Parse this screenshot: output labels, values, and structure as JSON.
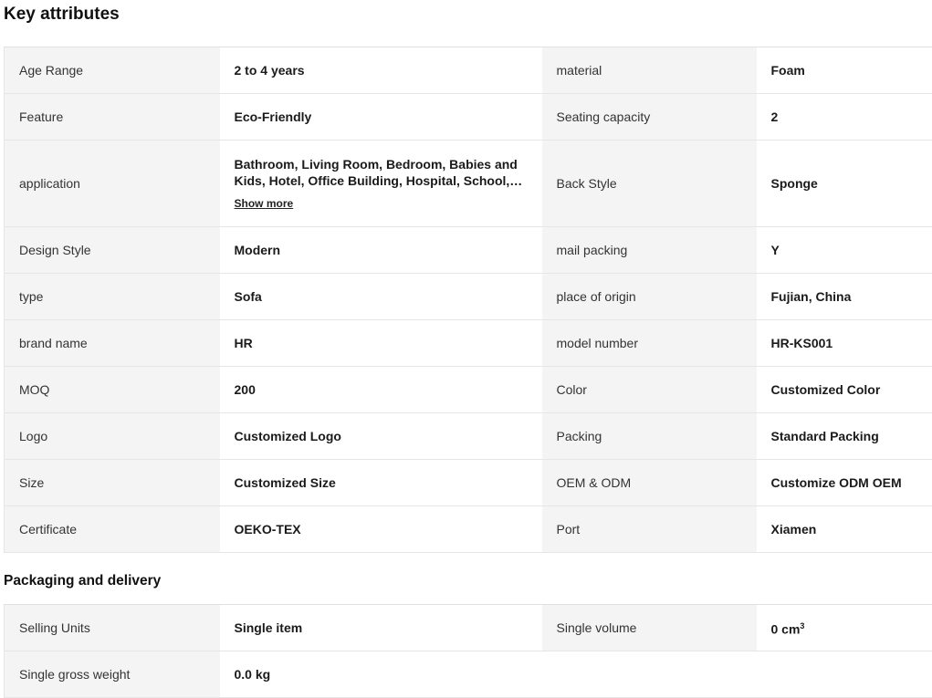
{
  "key_attributes": {
    "title": "Key attributes",
    "rows": [
      [
        {
          "label": "Age Range",
          "value": "2 to 4 years"
        },
        {
          "label": "material",
          "value": "Foam"
        }
      ],
      [
        {
          "label": "Feature",
          "value": "Eco-Friendly"
        },
        {
          "label": "Seating capacity",
          "value": "2"
        }
      ],
      [
        {
          "label": "application",
          "value": "Bathroom, Living Room, Bedroom, Babies and Kids, Hotel, Office Building, Hospital, School, Mall",
          "show_more": "Show more"
        },
        {
          "label": "Back Style",
          "value": "Sponge"
        }
      ],
      [
        {
          "label": "Design Style",
          "value": "Modern"
        },
        {
          "label": "mail packing",
          "value": "Y"
        }
      ],
      [
        {
          "label": "type",
          "value": "Sofa"
        },
        {
          "label": "place of origin",
          "value": "Fujian, China"
        }
      ],
      [
        {
          "label": "brand name",
          "value": "HR"
        },
        {
          "label": "model number",
          "value": "HR-KS001"
        }
      ],
      [
        {
          "label": "MOQ",
          "value": "200"
        },
        {
          "label": "Color",
          "value": "Customized Color"
        }
      ],
      [
        {
          "label": "Logo",
          "value": "Customized Logo"
        },
        {
          "label": "Packing",
          "value": "Standard Packing"
        }
      ],
      [
        {
          "label": "Size",
          "value": "Customized Size"
        },
        {
          "label": "OEM & ODM",
          "value": "Customize ODM OEM"
        }
      ],
      [
        {
          "label": "Certificate",
          "value": "OEKO-TEX"
        },
        {
          "label": "Port",
          "value": "Xiamen"
        }
      ]
    ]
  },
  "packaging": {
    "title": "Packaging and delivery",
    "rows": [
      [
        {
          "label": "Selling Units",
          "value": "Single item"
        },
        {
          "label": "Single volume",
          "value": "0 cm",
          "unit_sup": "3"
        }
      ],
      [
        {
          "label": "Single gross weight",
          "value": "0.0 kg"
        },
        {
          "label": "",
          "value": ""
        }
      ]
    ]
  }
}
